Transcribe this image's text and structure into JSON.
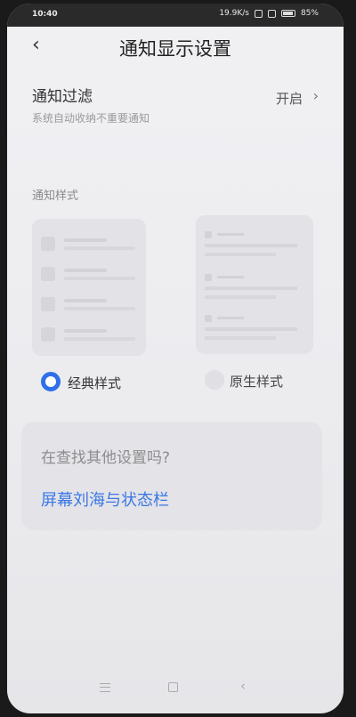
{
  "status_bar": {
    "time": "10:40",
    "network_speed": "19.9K/s",
    "battery": "85%"
  },
  "header": {
    "title": "通知显示设置"
  },
  "filter": {
    "title": "通知过滤",
    "description": "系统自动收纳不重要通知",
    "value": "开启"
  },
  "style_section": {
    "label": "通知样式",
    "options": [
      {
        "label": "经典样式",
        "selected": true
      },
      {
        "label": "原生样式",
        "selected": false
      }
    ]
  },
  "suggestion": {
    "question": "在查找其他设置吗?",
    "link": "屏幕刘海与状态栏"
  },
  "colors": {
    "accent": "#2f6fe8",
    "link": "#3a78e6"
  }
}
